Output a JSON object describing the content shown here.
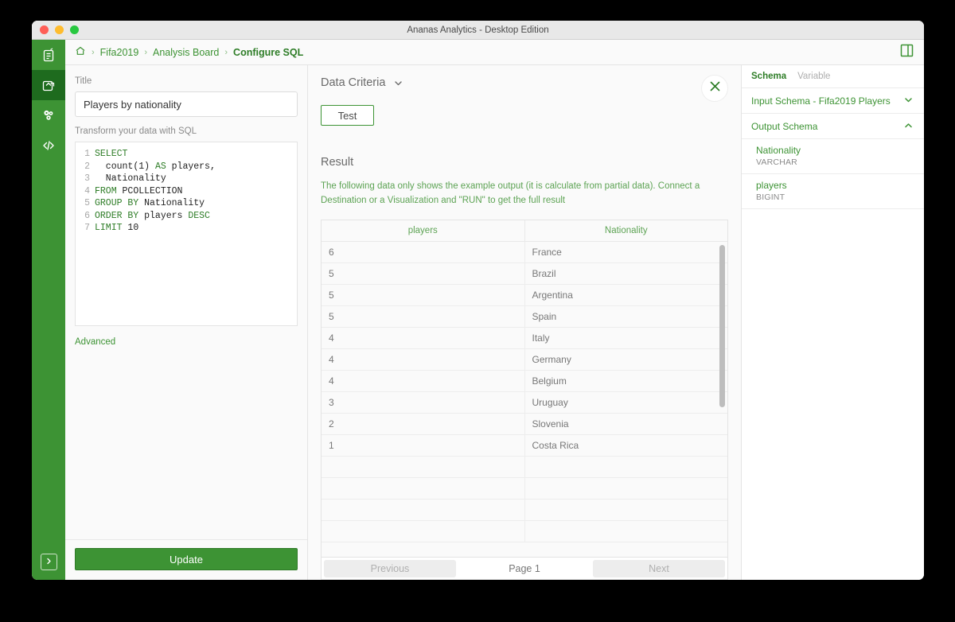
{
  "window": {
    "title": "Ananas Analytics - Desktop Edition"
  },
  "rail": {
    "items": [
      {
        "name": "data-source-icon",
        "active": false
      },
      {
        "name": "analysis-board-icon",
        "active": true
      },
      {
        "name": "gears-icon",
        "active": false
      },
      {
        "name": "code-icon",
        "active": false
      }
    ],
    "expand_toggle": "chevron-right-icon"
  },
  "breadcrumb": {
    "home": "home-icon",
    "items": [
      "Fifa2019",
      "Analysis Board",
      "Configure SQL"
    ],
    "separator": "›"
  },
  "sql_pane": {
    "title_label": "Title",
    "title_value": "Players by nationality",
    "title_placeholder": "Title",
    "sub_label": "Transform your data with SQL",
    "code_lines": [
      {
        "n": "1",
        "tokens": [
          {
            "t": "SELECT",
            "kw": true
          }
        ]
      },
      {
        "n": "2",
        "tokens": [
          {
            "t": "  count",
            "kw": false
          },
          {
            "t": "(1)",
            "kw": false
          },
          {
            "t": " ",
            "kw": false
          },
          {
            "t": "AS",
            "kw": true
          },
          {
            "t": " players,",
            "kw": false
          }
        ]
      },
      {
        "n": "3",
        "tokens": [
          {
            "t": "  Nationality",
            "kw": false
          }
        ]
      },
      {
        "n": "4",
        "tokens": [
          {
            "t": "FROM",
            "kw": true
          },
          {
            "t": " PCOLLECTION",
            "kw": false
          }
        ]
      },
      {
        "n": "5",
        "tokens": [
          {
            "t": "GROUP BY",
            "kw": true
          },
          {
            "t": " Nationality",
            "kw": false
          }
        ]
      },
      {
        "n": "6",
        "tokens": [
          {
            "t": "ORDER BY",
            "kw": true
          },
          {
            "t": " players ",
            "kw": false
          },
          {
            "t": "DESC",
            "kw": true
          }
        ]
      },
      {
        "n": "7",
        "tokens": [
          {
            "t": "LIMIT",
            "kw": true
          },
          {
            "t": " 10",
            "kw": false
          }
        ]
      }
    ],
    "advanced_label": "Advanced",
    "update_label": "Update"
  },
  "result_pane": {
    "criteria_title": "Data Criteria",
    "criteria_chevron": "chevron-down-icon",
    "close_icon": "close-icon",
    "test_label": "Test",
    "result_label": "Result",
    "notice": "The following data only shows the example output (it is calculate from partial data). Connect a Destination or a Visualization and \"RUN\" to get the full result",
    "table": {
      "columns": [
        "players",
        "Nationality"
      ],
      "rows": [
        [
          "6",
          "France"
        ],
        [
          "5",
          "Brazil"
        ],
        [
          "5",
          "Argentina"
        ],
        [
          "5",
          "Spain"
        ],
        [
          "4",
          "Italy"
        ],
        [
          "4",
          "Germany"
        ],
        [
          "4",
          "Belgium"
        ],
        [
          "3",
          "Uruguay"
        ],
        [
          "2",
          "Slovenia"
        ],
        [
          "1",
          "Costa Rica"
        ]
      ],
      "empty_rows": 4
    },
    "pager": {
      "previous_label": "Previous",
      "page_label": "Page 1",
      "next_label": "Next"
    }
  },
  "schema_pane": {
    "tabs": [
      {
        "label": "Schema",
        "active": true
      },
      {
        "label": "Variable",
        "active": false
      }
    ],
    "input_schema": {
      "label": "Input Schema - Fifa2019 Players",
      "chevron": "chevron-down-icon"
    },
    "output_schema": {
      "label": "Output Schema",
      "chevron": "chevron-up-icon"
    },
    "fields": [
      {
        "name": "Nationality",
        "type": "VARCHAR"
      },
      {
        "name": "players",
        "type": "BIGINT"
      }
    ]
  },
  "colors": {
    "brand_green": "#3d9334",
    "active_green": "#1e6b1e",
    "text_green": "#2e7d27",
    "notice_green": "#5da354"
  }
}
